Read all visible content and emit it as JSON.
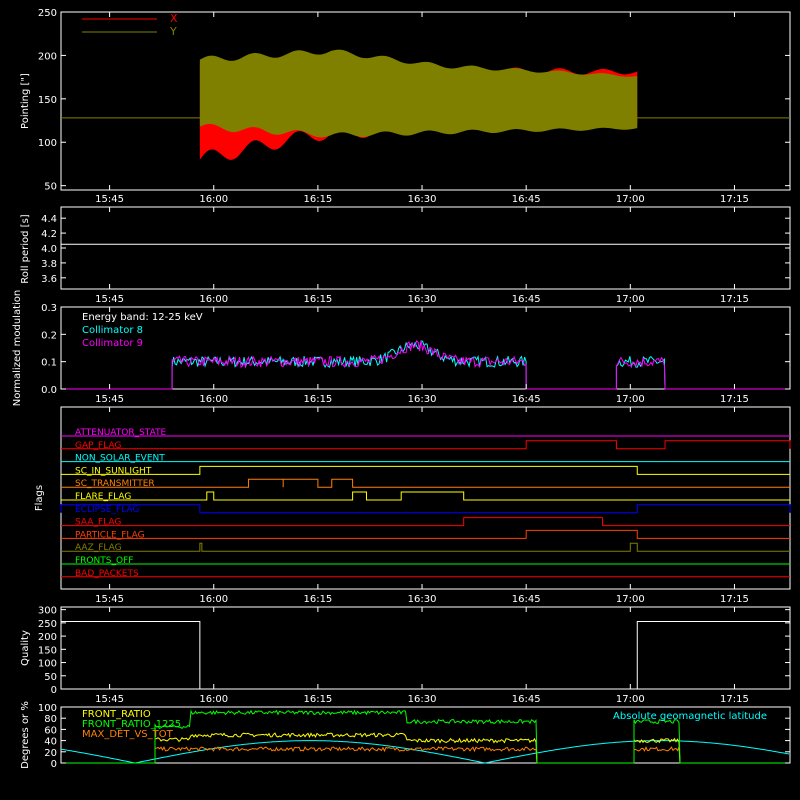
{
  "chart_data": [
    {
      "type": "area",
      "ylabel": "Pointing [\"]",
      "ylim": [
        45,
        250
      ],
      "yticks": [
        50,
        100,
        150,
        200,
        250
      ],
      "xlim": [
        "15:38",
        "17:23"
      ],
      "xticks": [
        "15:45",
        "16:00",
        "16:15",
        "16:30",
        "16:45",
        "17:00",
        "17:15"
      ],
      "legend_position": "top-left",
      "series": [
        {
          "name": "X",
          "color": "#ff0000",
          "start": "15:58",
          "end": "17:01",
          "upper": [
            [
              0,
              190
            ],
            [
              0.3,
              186
            ],
            [
              0.6,
              182
            ],
            [
              1,
              181
            ]
          ],
          "lower": [
            [
              0,
              80
            ],
            [
              0.25,
              108
            ],
            [
              0.6,
              118
            ],
            [
              1,
              120
            ]
          ]
        },
        {
          "name": "Y",
          "color": "#808000",
          "start": "15:58",
          "end": "17:01",
          "upper": [
            [
              0,
              195
            ],
            [
              0.3,
              205
            ],
            [
              0.55,
              188
            ],
            [
              1,
              176
            ]
          ],
          "lower": [
            [
              0,
              118
            ],
            [
              0.3,
              108
            ],
            [
              0.6,
              112
            ],
            [
              1,
              116
            ]
          ]
        }
      ],
      "reference_line": 128
    },
    {
      "type": "line",
      "ylabel": "Roll period [s]",
      "ylim": [
        3.45,
        4.55
      ],
      "yticks": [
        3.6,
        3.8,
        4.0,
        4.2,
        4.4
      ],
      "xticks": [
        "15:45",
        "16:00",
        "16:15",
        "16:30",
        "16:45",
        "17:00",
        "17:15"
      ],
      "constant": 4.05
    },
    {
      "type": "line",
      "ylabel": "Normalized modulation",
      "ylim": [
        0,
        0.3
      ],
      "yticks": [
        0,
        0.1,
        0.2,
        0.3
      ],
      "xticks": [
        "15:45",
        "16:00",
        "16:15",
        "16:30",
        "16:45",
        "17:00",
        "17:15"
      ],
      "annotation": "Energy band: 12-25 keV",
      "legend_position": "top-left",
      "series": [
        {
          "name": "Collimator 8",
          "color": "#00ffff"
        },
        {
          "name": "Collimator 9",
          "color": "#ff00ff"
        }
      ],
      "active_intervals": [
        [
          "15:54",
          "16:45"
        ],
        [
          "16:58",
          "17:05"
        ]
      ],
      "level": 0.1
    },
    {
      "type": "line",
      "ylabel": "Flags",
      "xticks": [
        "15:45",
        "16:00",
        "16:15",
        "16:30",
        "16:45",
        "17:00",
        "17:15"
      ],
      "flags": [
        {
          "name": "ATTENUATOR_STATE",
          "color": "#ff00ff",
          "on": []
        },
        {
          "name": "GAP_FLAG",
          "color": "#ff0000",
          "on": [
            [
              "16:45",
              "16:58"
            ],
            [
              "17:05",
              "17:23"
            ]
          ]
        },
        {
          "name": "NON_SOLAR_EVENT",
          "color": "#00ffff",
          "on": []
        },
        {
          "name": "SC_IN_SUNLIGHT",
          "color": "#ffff00",
          "on": [
            [
              "15:58",
              "17:01"
            ]
          ]
        },
        {
          "name": "SC_TRANSMITTER",
          "color": "#ff8000",
          "on": [
            [
              "16:05",
              "16:10"
            ],
            [
              "16:10",
              "16:15"
            ],
            [
              "16:17",
              "16:20"
            ]
          ]
        },
        {
          "name": "FLARE_FLAG",
          "color": "#ffff00",
          "on": [
            [
              "15:59",
              "16:00"
            ],
            [
              "16:20",
              "16:22"
            ],
            [
              "16:27",
              "16:36"
            ]
          ]
        },
        {
          "name": "ECLIPSE_FLAG",
          "color": "#0000ff",
          "on": [
            [
              "15:38",
              "15:58"
            ],
            [
              "17:01",
              "17:23"
            ]
          ]
        },
        {
          "name": "SAA_FLAG",
          "color": "#ff0000",
          "on": [
            [
              "16:36",
              "16:56"
            ]
          ]
        },
        {
          "name": "PARTICLE_FLAG",
          "color": "#ff4000",
          "on": [
            [
              "16:45",
              "17:01"
            ]
          ]
        },
        {
          "name": "AAZ_FLAG",
          "color": "#808000",
          "on": [
            [
              "15:58",
              "15:58"
            ],
            [
              "17:00",
              "17:01"
            ]
          ]
        },
        {
          "name": "FRONTS_OFF",
          "color": "#00ff00",
          "on": []
        },
        {
          "name": "BAD_PACKETS",
          "color": "#ff0000",
          "on": []
        }
      ]
    },
    {
      "type": "line",
      "ylabel": "Quality",
      "ylim": [
        0,
        310
      ],
      "yticks": [
        0,
        50,
        100,
        150,
        200,
        250,
        300
      ],
      "xticks": [
        "15:45",
        "16:00",
        "16:15",
        "16:30",
        "16:45",
        "17:00",
        "17:15"
      ],
      "points": [
        [
          "15:38",
          255
        ],
        [
          "15:58",
          255
        ],
        [
          "15:58",
          0
        ],
        [
          "17:01",
          0
        ],
        [
          "17:01",
          255
        ],
        [
          "17:23",
          255
        ]
      ]
    },
    {
      "type": "line",
      "ylabel": "Degrees or %",
      "ylim": [
        0,
        100
      ],
      "yticks": [
        0,
        20,
        40,
        60,
        80,
        100
      ],
      "xticks": [
        "15:45",
        "16:00",
        "16:15",
        "16:30",
        "16:45",
        "17:00",
        "17:15"
      ],
      "legend_position": "top-left",
      "series": [
        {
          "name": "FRONT_RATIO",
          "color": "#ffff00"
        },
        {
          "name": "FRONT_RATIO_1225",
          "color": "#00ff00"
        },
        {
          "name": "MAX_DET_VS_TOT",
          "color": "#ff8000"
        },
        {
          "name": "Absolute geomagnetic latitude",
          "color": "#00ffff"
        }
      ]
    }
  ]
}
